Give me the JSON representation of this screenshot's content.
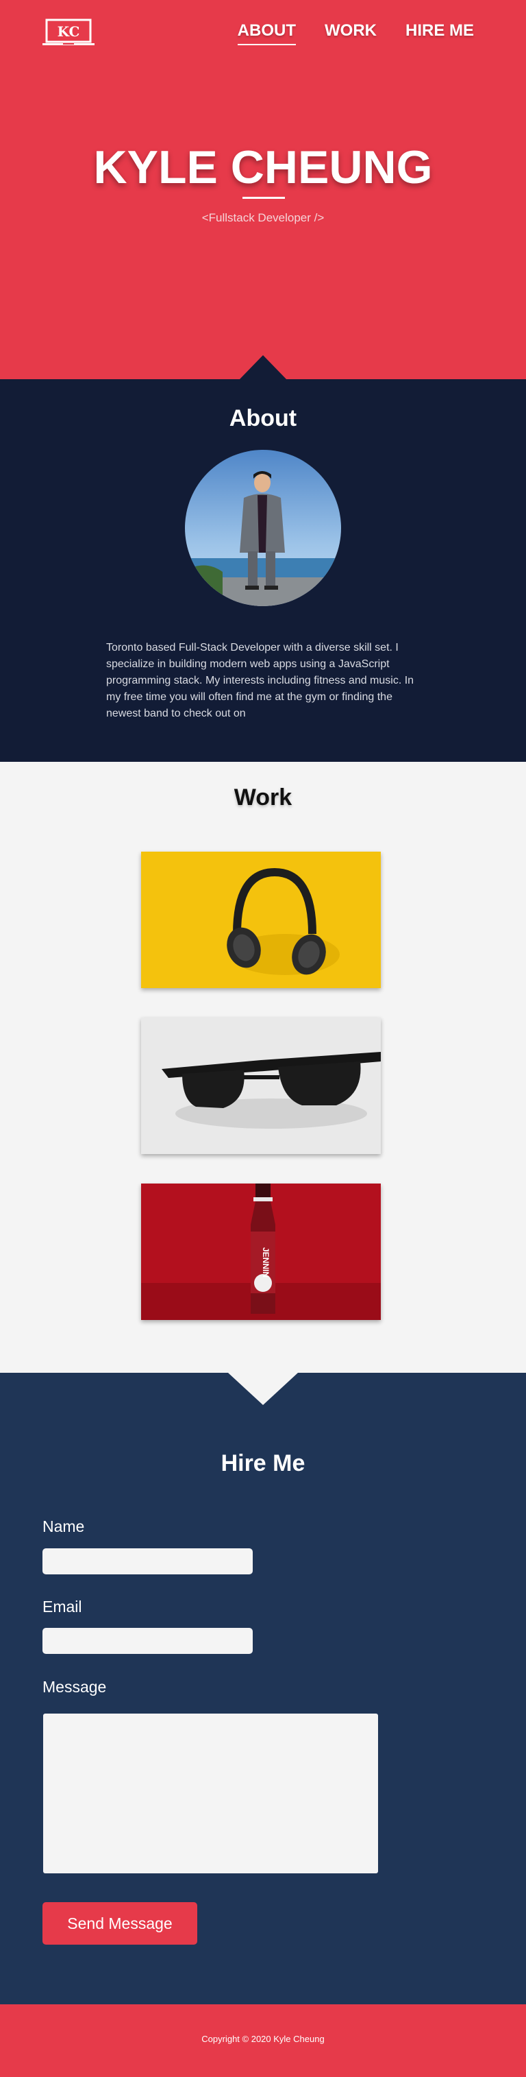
{
  "logo": {
    "text": "KC"
  },
  "nav": {
    "items": [
      {
        "label": "ABOUT",
        "active": true
      },
      {
        "label": "WORK",
        "active": false
      },
      {
        "label": "HIRE ME",
        "active": false
      }
    ]
  },
  "hero": {
    "title": "KYLE CHEUNG",
    "subtitle": "<Fullstack Developer />"
  },
  "about": {
    "title": "About",
    "text": "Toronto based Full-Stack Developer with a diverse skill set. I specialize in building modern web apps using a JavaScript programming stack. My interests including fitness and music. In my free time you will often find me at the gym or finding the newest band to check out on"
  },
  "work": {
    "title": "Work",
    "items": [
      {
        "subject": "headphones"
      },
      {
        "subject": "sunglasses"
      },
      {
        "subject": "bottle",
        "bottle_label": "JENNIN"
      }
    ]
  },
  "hire": {
    "title": "Hire Me",
    "name_label": "Name",
    "email_label": "Email",
    "message_label": "Message",
    "name_value": "",
    "email_value": "",
    "message_value": "",
    "send_label": "Send Message"
  },
  "footer": {
    "text": "Copyright © 2020 Kyle Cheung"
  },
  "colors": {
    "accent": "#e63a4a",
    "navy": "#121c36",
    "blue": "#1f3556",
    "light": "#f4f4f4"
  }
}
